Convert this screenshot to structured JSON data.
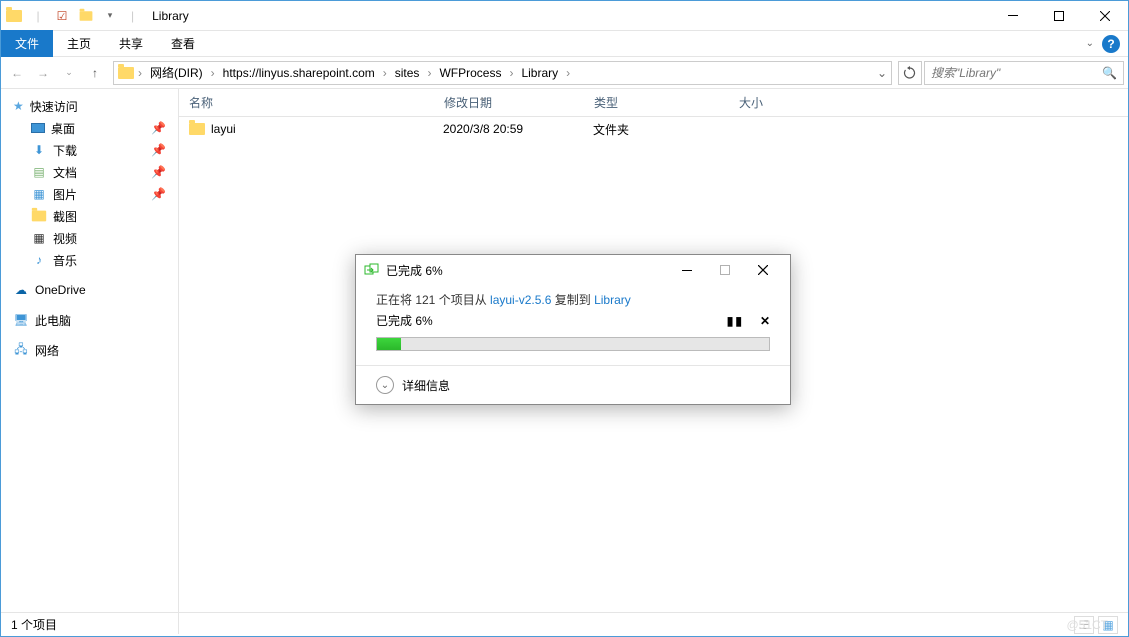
{
  "title_bar": {
    "window_title": "Library"
  },
  "ribbon": {
    "tabs": [
      "文件",
      "主页",
      "共享",
      "查看"
    ]
  },
  "breadcrumb": {
    "items": [
      "网络(DIR)",
      "https://linyus.sharepoint.com",
      "sites",
      "WFProcess",
      "Library"
    ]
  },
  "search": {
    "placeholder": "搜索\"Library\""
  },
  "sidebar": {
    "quick_access": "快速访问",
    "items": [
      {
        "label": "桌面",
        "icon": "desktop-icon",
        "pinned": true
      },
      {
        "label": "下载",
        "icon": "download-icon",
        "pinned": true
      },
      {
        "label": "文档",
        "icon": "documents-icon",
        "pinned": true
      },
      {
        "label": "图片",
        "icon": "pictures-icon",
        "pinned": true
      },
      {
        "label": "截图",
        "icon": "folder-icon",
        "pinned": false
      },
      {
        "label": "视频",
        "icon": "video-icon",
        "pinned": false
      },
      {
        "label": "音乐",
        "icon": "music-icon",
        "pinned": false
      }
    ],
    "groups": [
      {
        "label": "OneDrive",
        "icon": "onedrive-icon"
      },
      {
        "label": "此电脑",
        "icon": "pc-icon"
      },
      {
        "label": "网络",
        "icon": "network-icon"
      }
    ]
  },
  "columns": {
    "name": "名称",
    "date": "修改日期",
    "type": "类型",
    "size": "大小"
  },
  "rows": [
    {
      "name": "layui",
      "date": "2020/3/8 20:59",
      "type": "文件夹",
      "size": ""
    }
  ],
  "status_bar": {
    "item_count": "1 个项目"
  },
  "watermark": "@51CT",
  "dialog": {
    "title": "已完成 6%",
    "copy_prefix": "正在将 121 个项目从 ",
    "source": "layui-v2.5.6",
    "copy_mid": " 复制到 ",
    "dest": "Library",
    "progress_label": "已完成 6%",
    "progress_pct": 6,
    "details": "详细信息"
  }
}
